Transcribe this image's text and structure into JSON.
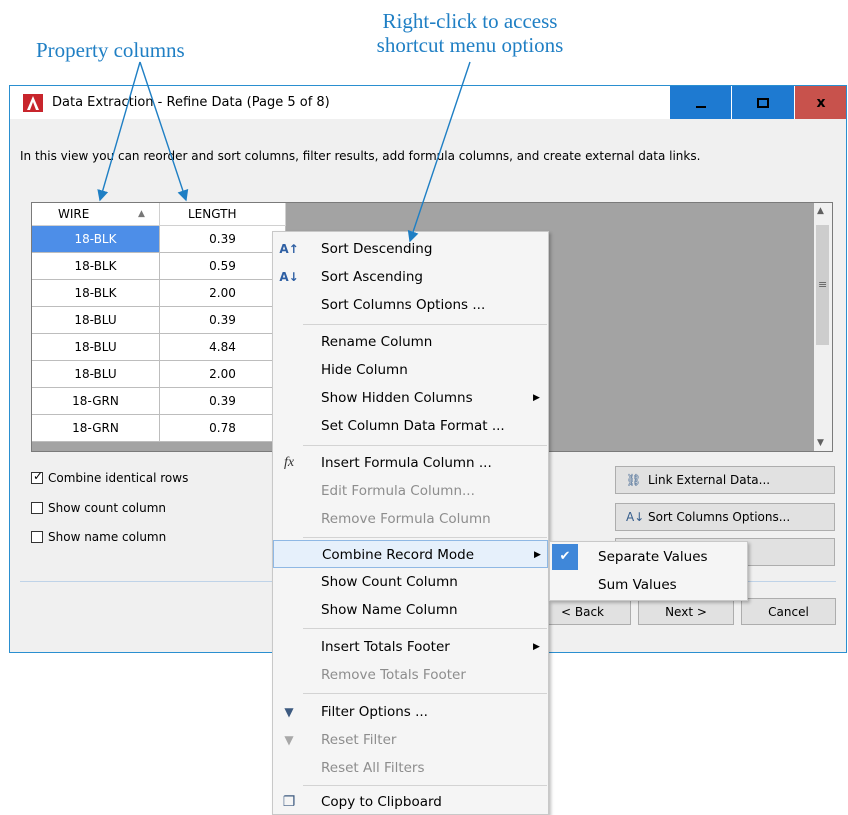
{
  "annotations": {
    "property_columns": "Property columns",
    "right_click_line1": "Right-click to access",
    "right_click_line2": "shortcut menu options"
  },
  "window": {
    "title": "Data Extraction - Refine Data (Page 5 of 8)",
    "minimize": "",
    "maximize": "",
    "close": "x"
  },
  "intro_text": "In this view you can reorder and sort columns, filter results, add formula columns, and create external data links.",
  "grid": {
    "columns": [
      "WIRE",
      "LENGTH"
    ],
    "rows": [
      {
        "wire": "18-BLK",
        "length": "0.39"
      },
      {
        "wire": "18-BLK",
        "length": "0.59"
      },
      {
        "wire": "18-BLK",
        "length": "2.00"
      },
      {
        "wire": "18-BLU",
        "length": "0.39"
      },
      {
        "wire": "18-BLU",
        "length": "4.84"
      },
      {
        "wire": "18-BLU",
        "length": "2.00"
      },
      {
        "wire": "18-GRN",
        "length": "0.39"
      },
      {
        "wire": "18-GRN",
        "length": "0.78"
      }
    ]
  },
  "options": {
    "combine_identical_rows": "Combine identical rows",
    "show_count_column": "Show count column",
    "show_name_column": "Show name column"
  },
  "side_buttons": {
    "link_external_data": "Link External Data...",
    "sort_columns_options": "Sort Columns Options..."
  },
  "nav": {
    "back": "< Back",
    "next": "Next >",
    "cancel": "Cancel"
  },
  "context_menu": {
    "sort_descending": "Sort Descending",
    "sort_ascending": "Sort Ascending",
    "sort_columns_options": "Sort Columns Options ...",
    "rename_column": "Rename Column",
    "hide_column": "Hide Column",
    "show_hidden_columns": "Show Hidden Columns",
    "set_column_data_format": "Set Column Data Format ...",
    "insert_formula_column": "Insert Formula Column ...",
    "edit_formula_column": "Edit Formula Column...",
    "remove_formula_column": "Remove Formula Column",
    "combine_record_mode": "Combine Record Mode",
    "show_count_column": "Show Count Column",
    "show_name_column": "Show Name Column",
    "insert_totals_footer": "Insert Totals Footer",
    "remove_totals_footer": "Remove Totals Footer",
    "filter_options": "Filter Options ...",
    "reset_filter": "Reset Filter",
    "reset_all_filters": "Reset All Filters",
    "copy_to_clipboard": "Copy to Clipboard"
  },
  "submenu": {
    "separate_values": "Separate Values",
    "sum_values": "Sum Values"
  },
  "colors": {
    "annotation": "#1f7fc4",
    "title_buttons": "#1e7ad1",
    "close_button": "#c8524c",
    "selection": "#4d8ee8"
  }
}
